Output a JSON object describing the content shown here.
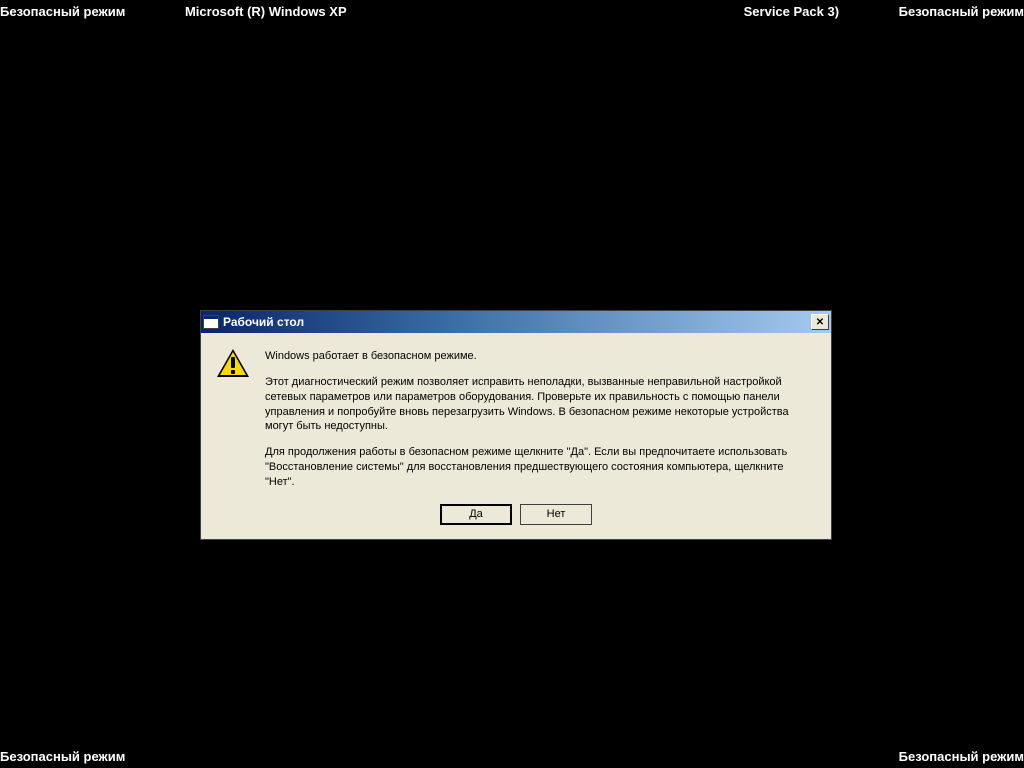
{
  "corners": {
    "safe_mode": "Безопасный режим"
  },
  "header": {
    "os_info_left": "Microsoft (R) Windows XP",
    "os_info_right": "Service Pack 3)"
  },
  "dialog": {
    "title": "Рабочий стол",
    "close_symbol": "✕",
    "paragraph1": "Windows работает в безопасном режиме.",
    "paragraph2": "Этот диагностический режим позволяет исправить неполадки, вызванные неправильной настройкой сетевых параметров или параметров оборудования. Проверьте их правильность с помощью панели управления и попробуйте вновь перезагрузить Windows. В безопасном режиме некоторые устройства могут быть недоступны.",
    "paragraph3": "Для продолжения работы в безопасном режиме щелкните \"Да\". Если вы предпочитаете использовать \"Восстановление системы\" для восстановления предшествующего состояния компьютера, щелкните \"Нет\".",
    "buttons": {
      "yes": "Да",
      "no": "Нет"
    }
  }
}
